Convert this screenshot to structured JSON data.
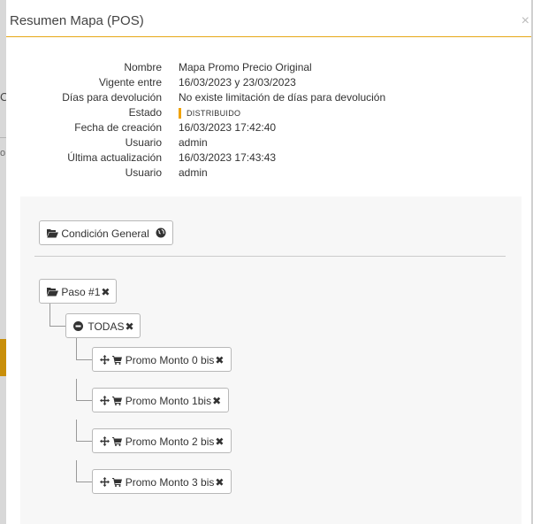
{
  "modal": {
    "title": "Resumen Mapa (POS)",
    "close_glyph": "×"
  },
  "background": {
    "left_letter": "C",
    "left_small": "o"
  },
  "info": {
    "rows": [
      {
        "label": "Nombre",
        "value": "Mapa Promo Precio Original"
      },
      {
        "label": "Vigente entre",
        "value": "16/03/2023 y 23/03/2023"
      },
      {
        "label": "Días para devolución",
        "value": "No existe limitación de días para devolución"
      },
      {
        "label": "Estado",
        "value": "DISTRIBUIDO"
      },
      {
        "label": "Fecha de creación",
        "value": "16/03/2023 17:42:40"
      },
      {
        "label": "Usuario",
        "value": "admin"
      },
      {
        "label": "Última actualización",
        "value": "16/03/2023 17:43:43"
      },
      {
        "label": "Usuario",
        "value": "admin"
      }
    ]
  },
  "tree": {
    "general": {
      "label": "Condición General",
      "icon": "folder-open-icon",
      "trailing_icon": "globe-icon"
    },
    "step": {
      "label": "Paso #1",
      "icon": "folder-open-icon",
      "remove_glyph": "✖"
    },
    "group": {
      "label": "TODAS",
      "icon": "minus-circle-icon",
      "remove_glyph": "✖"
    },
    "items": [
      {
        "label": "Promo Monto 0 bis",
        "remove_glyph": "✖"
      },
      {
        "label": "Promo Monto 1bis",
        "remove_glyph": "✖"
      },
      {
        "label": "Promo Monto 2 bis",
        "remove_glyph": "✖"
      },
      {
        "label": "Promo Monto 3 bis",
        "remove_glyph": "✖"
      }
    ]
  },
  "colors": {
    "accent": "#e6a817",
    "badge": "#f0a30a",
    "panel_bg": "#f7f7f7"
  }
}
